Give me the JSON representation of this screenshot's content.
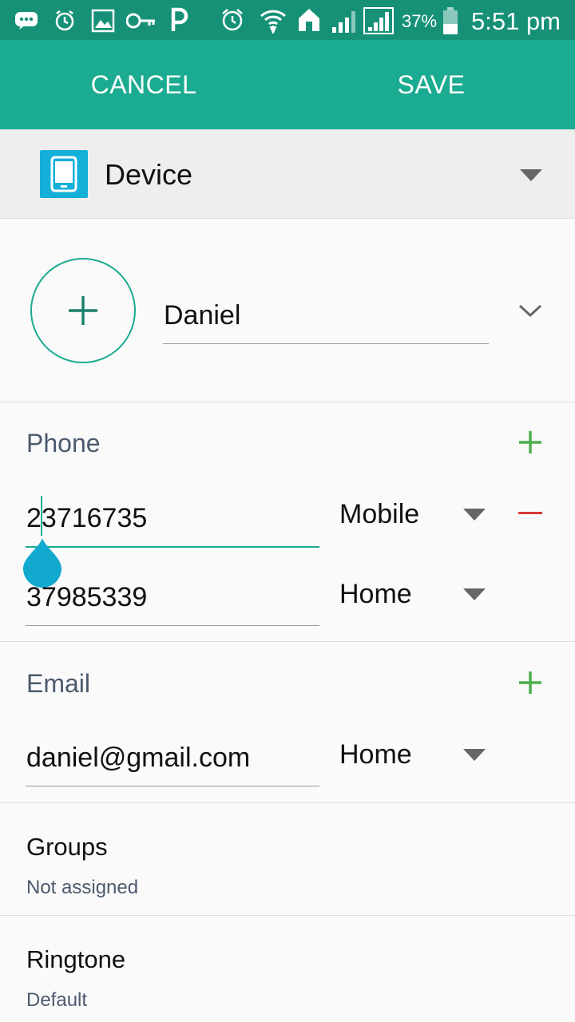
{
  "status_bar": {
    "battery_percent": "37%",
    "time": "5:51 pm",
    "icons": [
      "messages-icon",
      "alarm-icon",
      "image-icon",
      "key-icon",
      "p-app-icon",
      "alarm-clock-icon",
      "wifi-icon",
      "home-icon",
      "signal-icon",
      "signal-icon",
      "battery-icon"
    ]
  },
  "action_bar": {
    "cancel_label": "CANCEL",
    "save_label": "SAVE"
  },
  "account": {
    "label": "Device",
    "icon": "device-icon"
  },
  "name": {
    "value": "Daniel"
  },
  "phone": {
    "title": "Phone",
    "entries": [
      {
        "number": "23716735",
        "type": "Mobile"
      },
      {
        "number": "37985339",
        "type": "Home"
      }
    ]
  },
  "email": {
    "title": "Email",
    "entries": [
      {
        "address": "daniel@gmail.com",
        "type": "Home"
      }
    ]
  },
  "groups": {
    "title": "Groups",
    "value": "Not assigned"
  },
  "ringtone": {
    "title": "Ringtone",
    "value": "Default"
  },
  "colors": {
    "accent": "#1bab91",
    "status_bar": "#169178",
    "add_green": "#4caf50",
    "remove_red": "#d9393a",
    "cursor_handle": "#12a9cf"
  }
}
